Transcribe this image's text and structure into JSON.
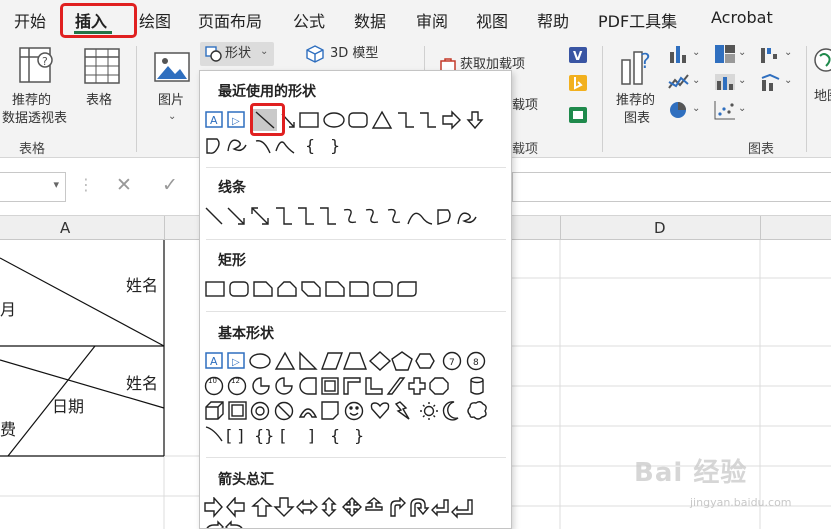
{
  "menu": {
    "tabs": [
      "开始",
      "插入",
      "绘图",
      "页面布局",
      "公式",
      "数据",
      "审阅",
      "视图",
      "帮助",
      "PDF工具集",
      "Acrobat"
    ],
    "active_tab": "插入"
  },
  "ribbon": {
    "pivot_line1": "推荐的",
    "pivot_line2": "数据透视表",
    "table": "表格",
    "group_tables": "表格",
    "pictures": "图片",
    "shapes": "形状",
    "model3d": "3D 模型",
    "get_addins": "获取加载项",
    "addins_partial": "载项",
    "group_addins_partial": "载项",
    "rec_chart_line1": "推荐的",
    "rec_chart_line2": "图表",
    "group_charts": "图表",
    "maps_partial": "地图"
  },
  "sheet": {
    "columns": [
      "A",
      "D"
    ],
    "cells": {
      "name1": "姓名",
      "partial1": "月",
      "name2": "姓名",
      "date2": "日期",
      "partial2": "费"
    }
  },
  "shapes_panel": {
    "sections": [
      "最近使用的形状",
      "线条",
      "矩形",
      "基本形状",
      "箭头总汇"
    ],
    "braces": [
      "{",
      "}"
    ],
    "basic_row4": [
      "[",
      "]",
      "{",
      "}"
    ],
    "octagon_labels": [
      "7",
      "8"
    ],
    "decagon_labels": [
      "10",
      "12"
    ]
  },
  "watermark": {
    "brand": "Bai 经验",
    "url": "jingyan.baidu.com"
  },
  "colors": {
    "accent_green": "#217346",
    "highlight_red": "#e02020",
    "shape_blue": "#2f6fbf"
  }
}
